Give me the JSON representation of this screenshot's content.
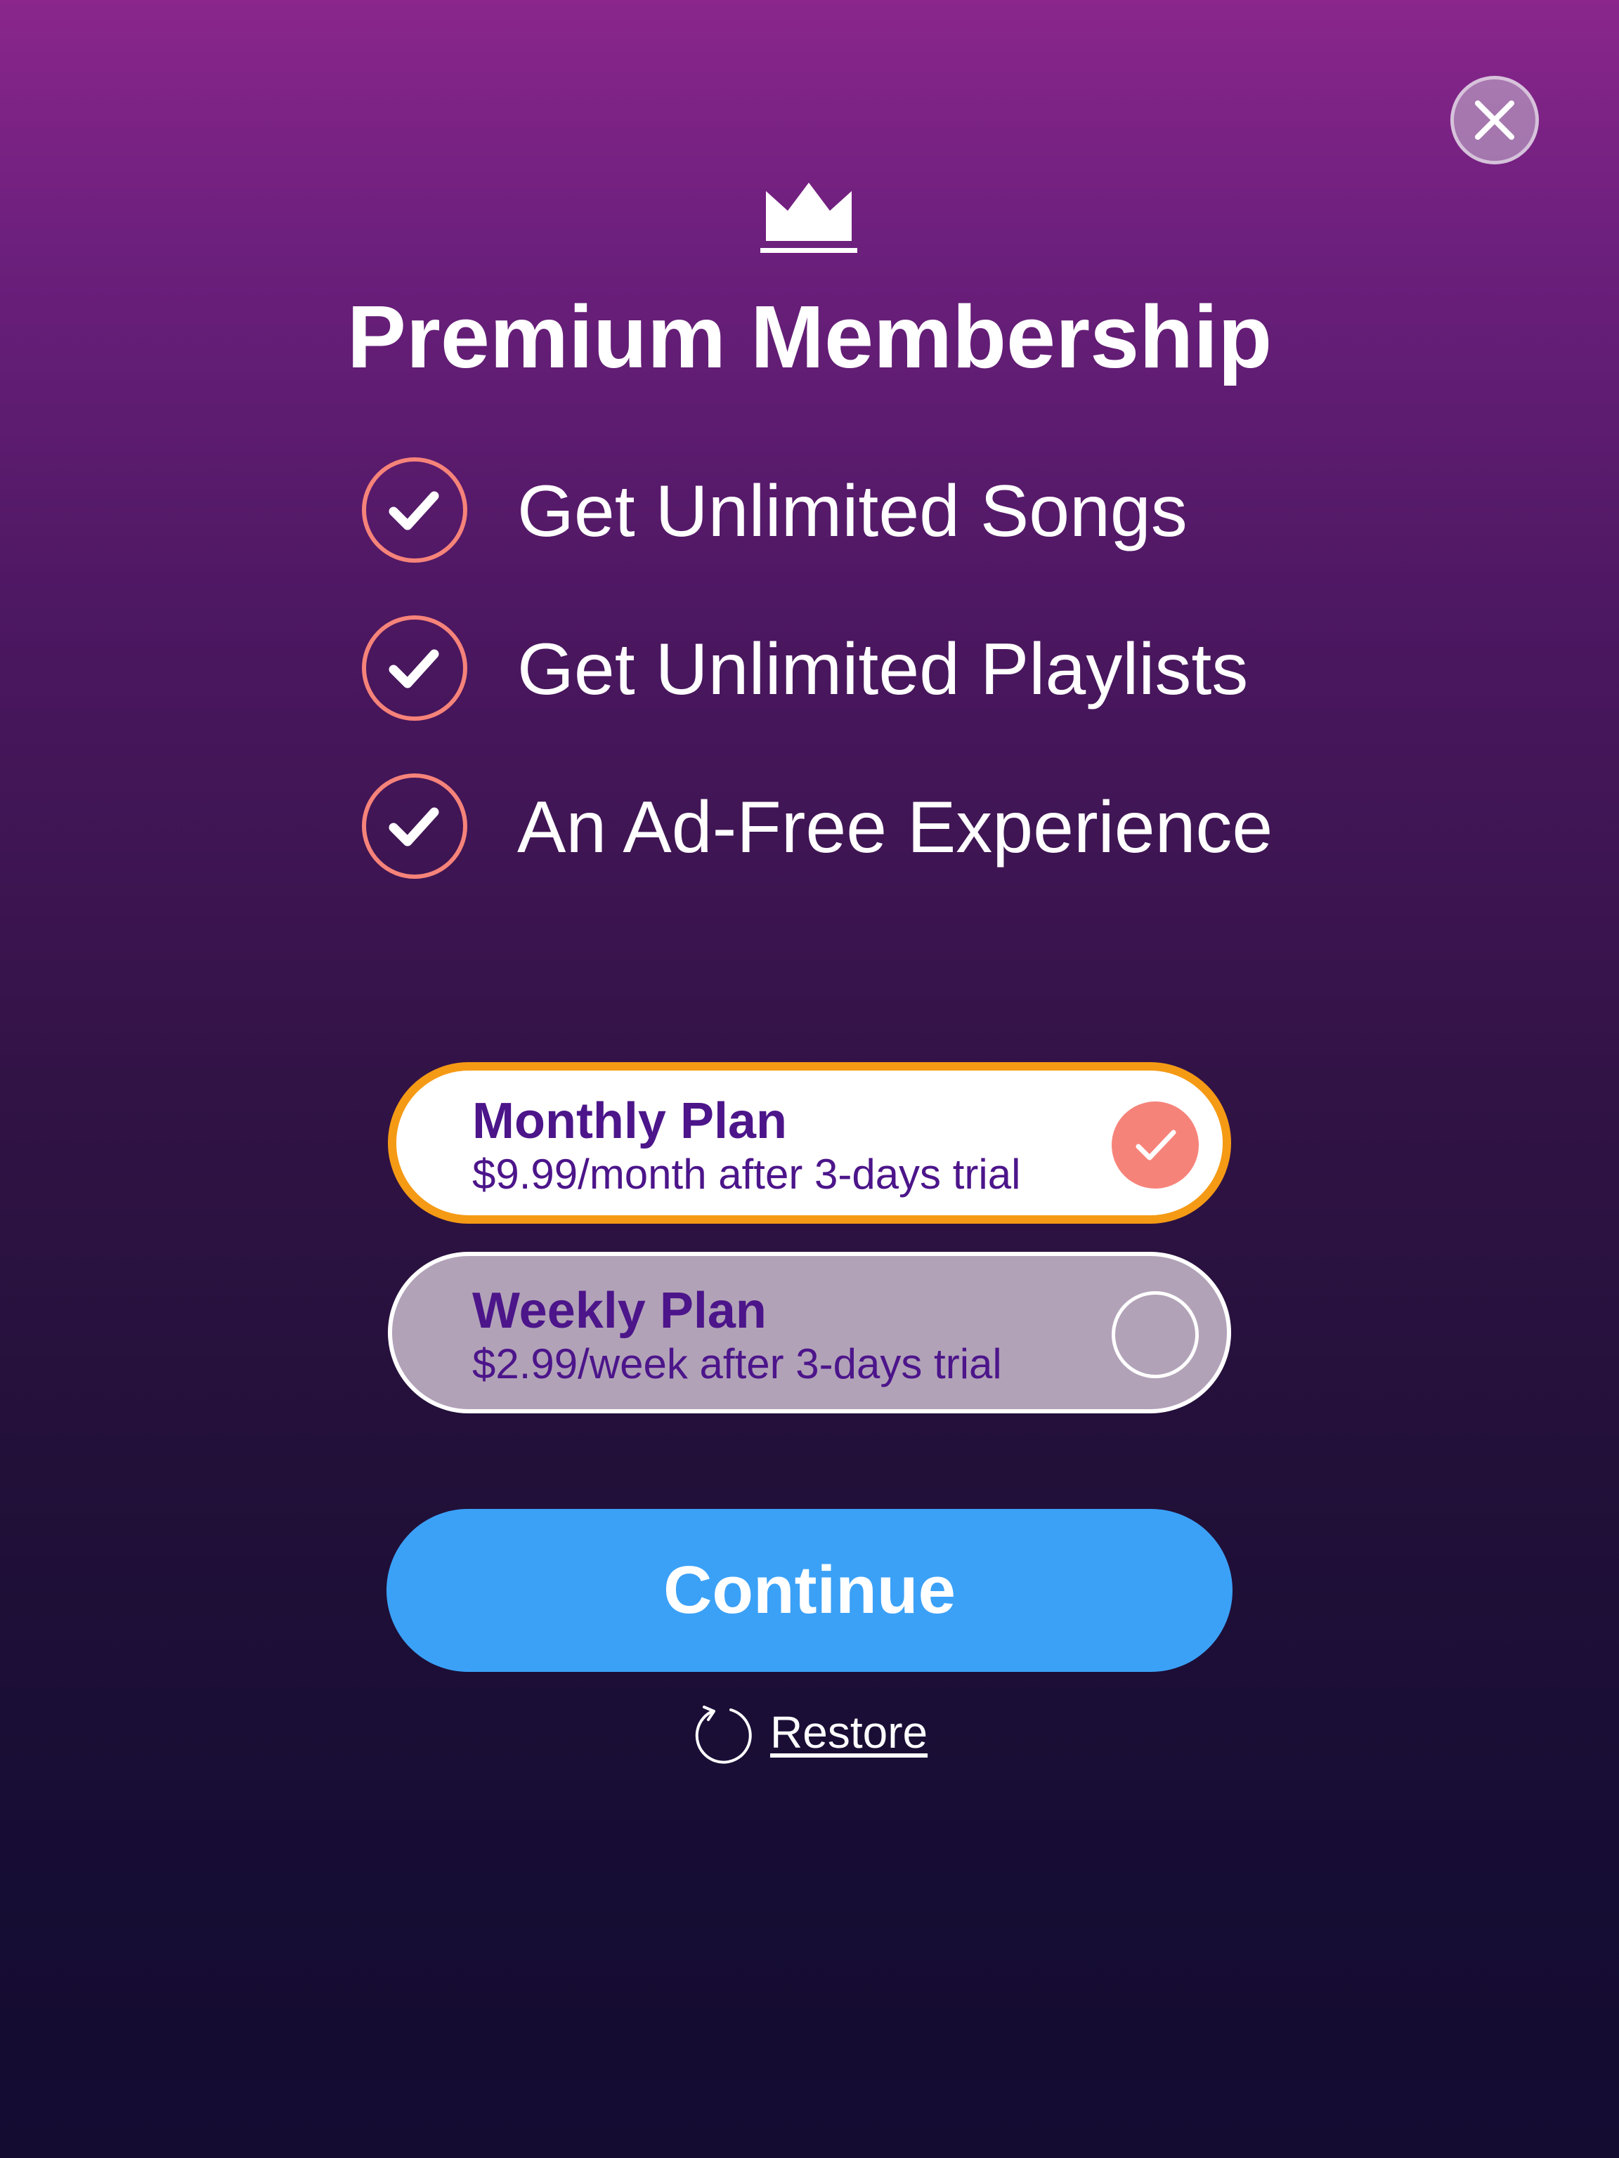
{
  "header": {
    "close_icon": "close-icon",
    "crown_icon": "crown-icon",
    "title": "Premium Membership"
  },
  "features": [
    {
      "icon": "check-circle-icon",
      "label": "Get Unlimited Songs"
    },
    {
      "icon": "check-circle-icon",
      "label": "Get Unlimited Playlists"
    },
    {
      "icon": "check-circle-icon",
      "label": "An Ad-Free Experience"
    }
  ],
  "plans": [
    {
      "name": "Monthly Plan",
      "price": "$9.99/month after 3-days trial",
      "selected": true
    },
    {
      "name": "Weekly Plan",
      "price": "$2.99/week after 3-days trial",
      "selected": false
    }
  ],
  "actions": {
    "continue_label": "Continue",
    "restore_label": "Restore",
    "restore_icon": "restore-icon"
  },
  "colors": {
    "gradient_top": "#8a268c",
    "gradient_bottom": "#140c31",
    "accent_blue": "#3ba1f7",
    "selected_border": "#f59a14",
    "check_coral": "#f6837a",
    "plan_text": "#4c158a"
  }
}
